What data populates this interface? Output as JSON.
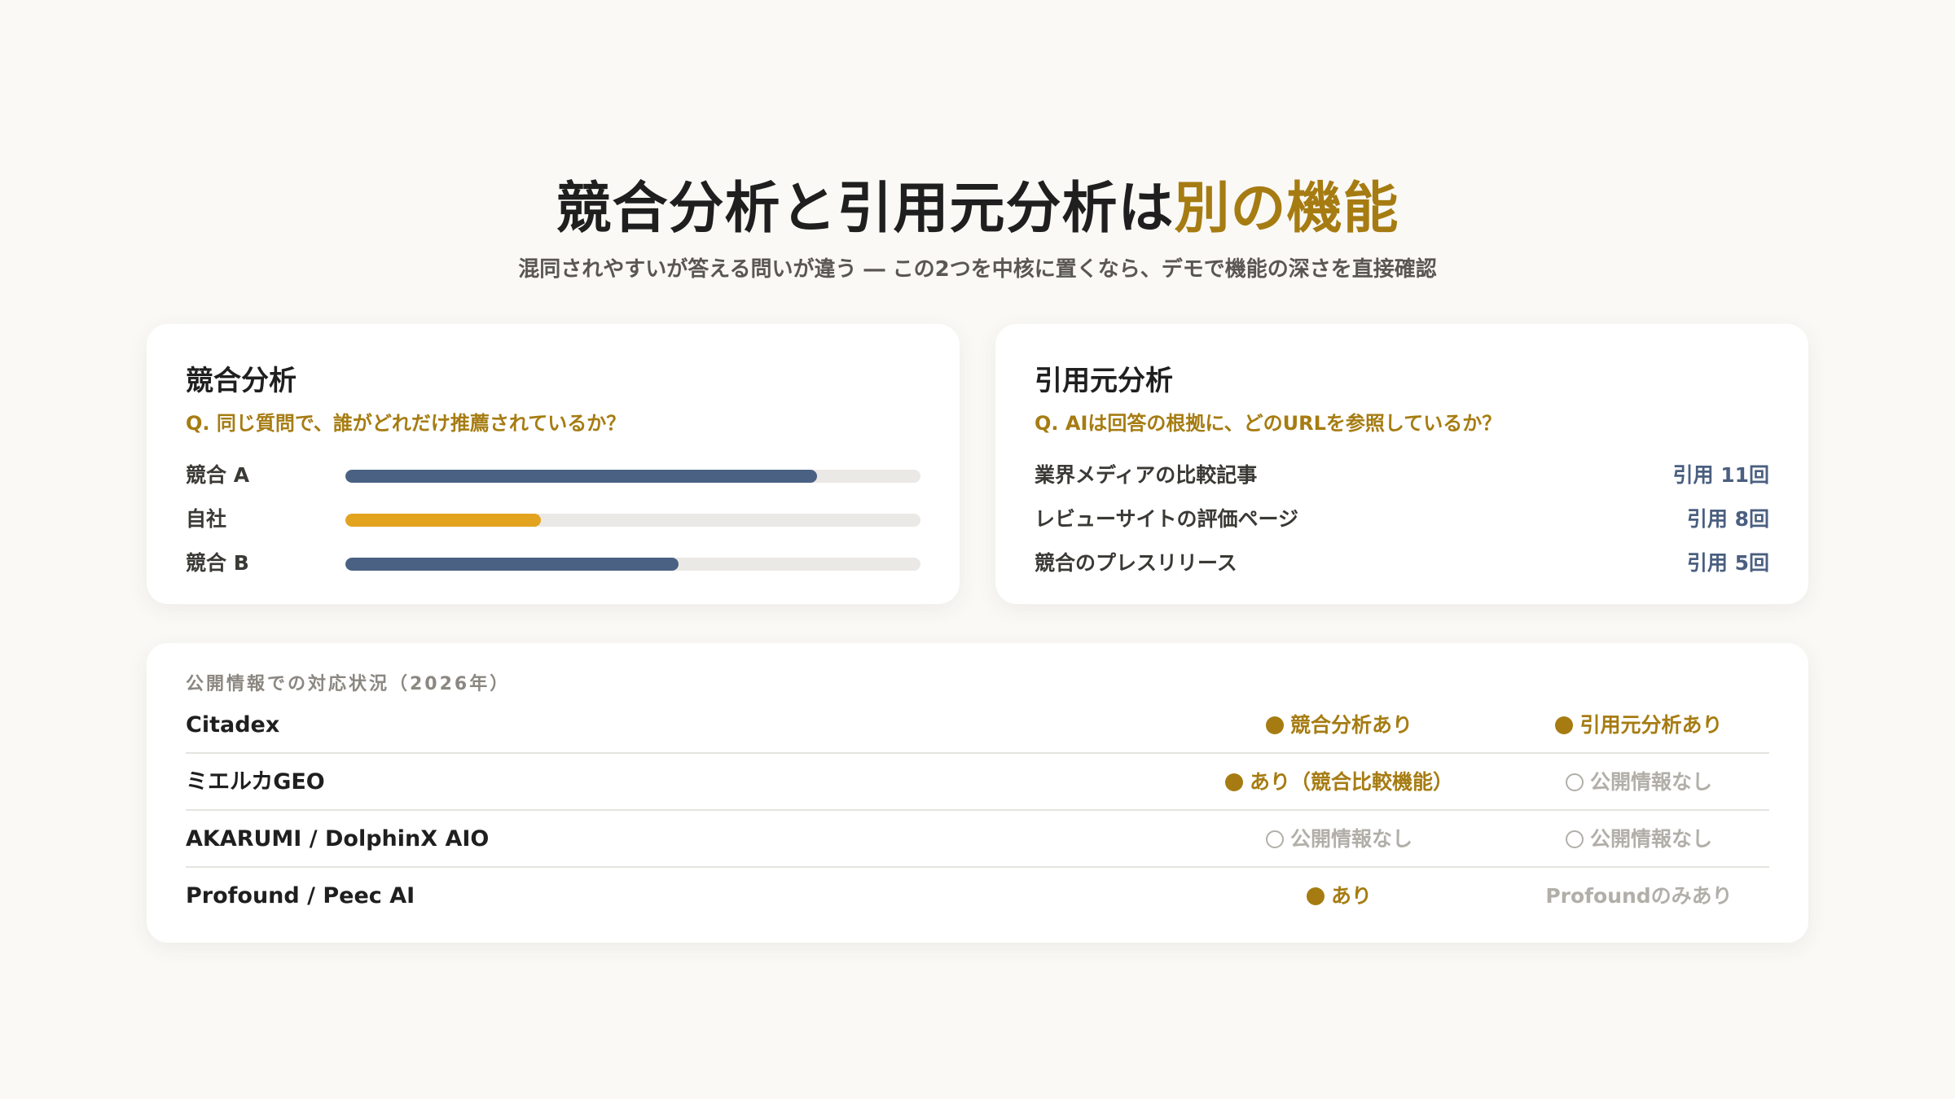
{
  "header": {
    "title_main": "競合分析と引用元分析は",
    "title_accent": "別の機能",
    "subtitle": "混同されやすいが答える問いが違う ― この2つを中核に置くなら、デモで機能の深さを直接確認"
  },
  "colors": {
    "accent": "#a67c12",
    "bar_competitor": "#4a6184",
    "bar_self": "#e2a31f",
    "track": "#ebe9e5",
    "citation_count": "#4a5f80",
    "muted": "#b2afa9"
  },
  "competitor_card": {
    "title": "競合分析",
    "question": "Q. 同じ質問で、誰がどれだけ推薦されているか？",
    "bars": [
      {
        "label": "競合 A",
        "value": 0.82,
        "color": "#4a6184"
      },
      {
        "label": "自社",
        "value": 0.34,
        "color": "#e2a31f"
      },
      {
        "label": "競合 B",
        "value": 0.58,
        "color": "#4a6184"
      }
    ]
  },
  "citation_card": {
    "title": "引用元分析",
    "question": "Q. AIは回答の根拠に、どのURLを参照しているか？",
    "rows": [
      {
        "label": "業界メディアの比較記事",
        "count": "引用 11回"
      },
      {
        "label": "レビューサイトの評価ページ",
        "count": "引用 8回"
      },
      {
        "label": "競合のプレスリリース",
        "count": "引用 5回"
      }
    ]
  },
  "status_card": {
    "heading": "公開情報での対応状況（2026年）",
    "rows": [
      {
        "name": "Citadex",
        "col1": {
          "text": "競合分析あり",
          "state": "yes"
        },
        "col2": {
          "text": "引用元分析あり",
          "state": "yes"
        }
      },
      {
        "name": "ミエルカGEO",
        "col1": {
          "text": "あり（競合比較機能）",
          "state": "yes"
        },
        "col2": {
          "text": "公開情報なし",
          "state": "no"
        }
      },
      {
        "name": "AKARUMI / DolphinX AIO",
        "col1": {
          "text": "公開情報なし",
          "state": "no"
        },
        "col2": {
          "text": "公開情報なし",
          "state": "no"
        }
      },
      {
        "name": "Profound / Peec AI",
        "col1": {
          "text": "あり",
          "state": "yes"
        },
        "col2": {
          "text": "Profoundのみあり",
          "state": "partial"
        }
      }
    ]
  }
}
